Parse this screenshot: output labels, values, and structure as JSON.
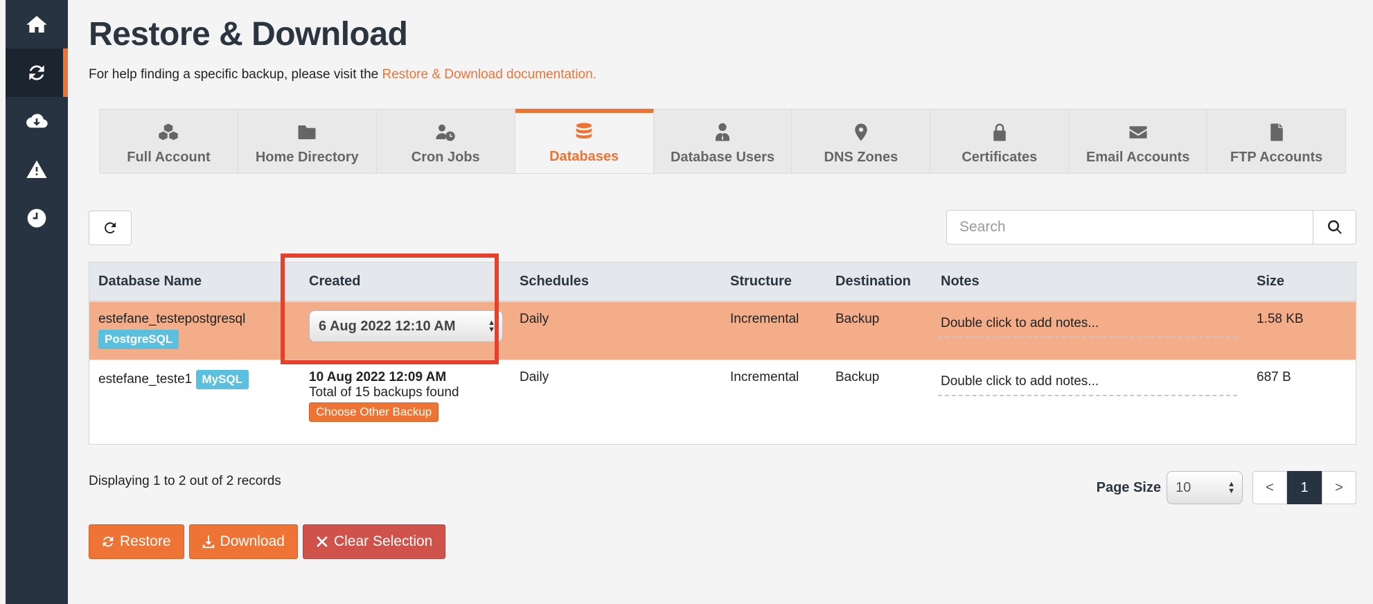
{
  "sidebar": {
    "items": [
      {
        "name": "home",
        "icon": "home-icon",
        "active": false
      },
      {
        "name": "restore",
        "icon": "refresh-icon",
        "active": true
      },
      {
        "name": "cloud-download",
        "icon": "cloud-download-icon",
        "active": false
      },
      {
        "name": "warning",
        "icon": "warning-icon",
        "active": false
      },
      {
        "name": "clock",
        "icon": "clock-icon",
        "active": false
      }
    ]
  },
  "page": {
    "title": "Restore & Download",
    "help_text": "For help finding a specific backup, please visit the ",
    "help_link": "Restore & Download documentation."
  },
  "tabs": [
    {
      "label": "Full Account",
      "icon": "cubes-icon",
      "active": false
    },
    {
      "label": "Home Directory",
      "icon": "folder-icon",
      "active": false
    },
    {
      "label": "Cron Jobs",
      "icon": "user-clock-icon",
      "active": false
    },
    {
      "label": "Databases",
      "icon": "database-icon",
      "active": true
    },
    {
      "label": "Database Users",
      "icon": "user-tie-icon",
      "active": false
    },
    {
      "label": "DNS Zones",
      "icon": "map-marker-icon",
      "active": false
    },
    {
      "label": "Certificates",
      "icon": "lock-icon",
      "active": false
    },
    {
      "label": "Email Accounts",
      "icon": "envelope-icon",
      "active": false
    },
    {
      "label": "FTP Accounts",
      "icon": "file-icon",
      "active": false
    }
  ],
  "search": {
    "placeholder": "Search"
  },
  "table": {
    "columns": [
      "Database Name",
      "Created",
      "Schedules",
      "Structure",
      "Destination",
      "Notes",
      "Size"
    ],
    "rows": [
      {
        "name": "estefane_testepostgresql",
        "type": "PostgreSQL",
        "created": "6 Aug 2022 12:10 AM",
        "schedules": "Daily",
        "structure": "Incremental",
        "destination": "Backup",
        "notes": "Double click to add notes...",
        "size": "1.58 KB",
        "selected": true
      },
      {
        "name": "estefane_teste1",
        "type": "MySQL",
        "created": "10 Aug 2022 12:09 AM",
        "backups_found": "Total of 15 backups found",
        "choose_label": "Choose Other Backup",
        "schedules": "Daily",
        "structure": "Incremental",
        "destination": "Backup",
        "notes": "Double click to add notes...",
        "size": "687 B",
        "selected": false
      }
    ]
  },
  "footer": {
    "displaying": "Displaying 1 to 2 out of 2 records",
    "page_size_label": "Page Size",
    "page_size": "10",
    "prev": "<",
    "current_page": "1",
    "next": ">"
  },
  "actions": {
    "restore": "Restore",
    "download": "Download",
    "clear": "Clear Selection"
  },
  "colors": {
    "accent": "#ee7435",
    "sidebar": "#273340",
    "selected_row": "#f3ae89",
    "badge": "#5bc0de",
    "danger": "#d0534b",
    "highlight_box": "#e8402a"
  }
}
